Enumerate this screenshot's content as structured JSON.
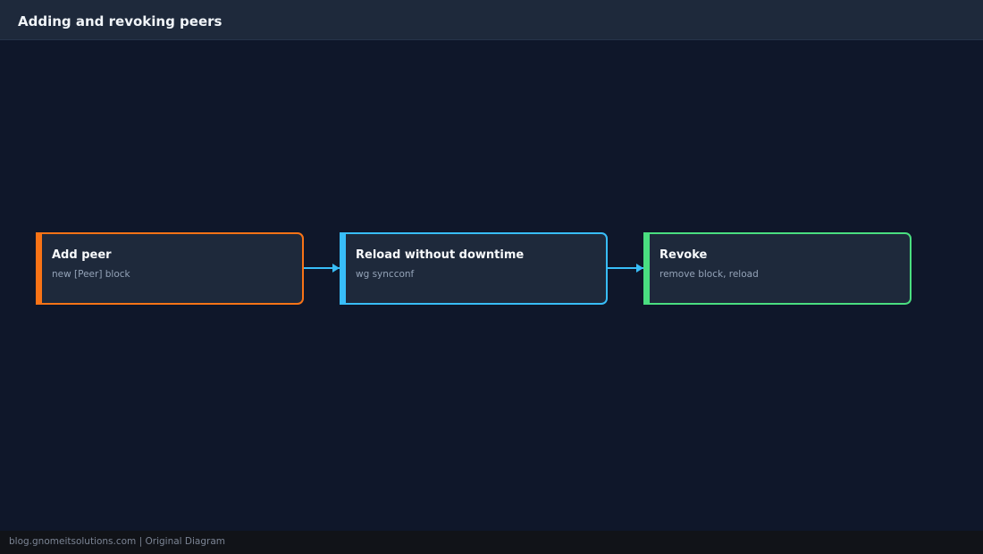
{
  "header": {
    "title": "Adding and revoking peers"
  },
  "nodes": [
    {
      "title": "Add peer",
      "subtitle": "new [Peer] block",
      "color": "#f97316"
    },
    {
      "title": "Reload without downtime",
      "subtitle": "wg syncconf",
      "color": "#38bdf8"
    },
    {
      "title": "Revoke",
      "subtitle": "remove block, reload",
      "color": "#4ade80"
    }
  ],
  "edges": [
    {
      "from": "Add peer",
      "to": "Reload without downtime"
    },
    {
      "from": "Reload without downtime",
      "to": "Revoke"
    }
  ],
  "edge_color": "#38bdf8",
  "footer": {
    "text": "blog.gnomeitsolutions.com | Original Diagram"
  }
}
